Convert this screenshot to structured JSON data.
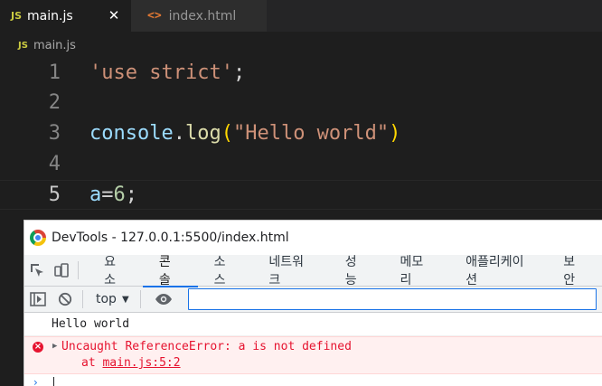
{
  "editor": {
    "tabs": [
      {
        "icon": "JS",
        "label": "main.js",
        "close": "✕"
      },
      {
        "icon": "<>",
        "label": "index.html"
      }
    ],
    "breadcrumb": {
      "icon": "JS",
      "label": "main.js"
    },
    "lines": [
      {
        "number": "1"
      },
      {
        "number": "2"
      },
      {
        "number": "3"
      },
      {
        "number": "4"
      },
      {
        "number": "5"
      }
    ],
    "code": {
      "l1_str": "'use strict'",
      "l1_semi": ";",
      "l3_obj": "console",
      "l3_dot": ".",
      "l3_fn": "log",
      "l3_open": "(",
      "l3_str": "\"Hello world\"",
      "l3_close": ")",
      "l5_var": "a",
      "l5_eq": "=",
      "l5_num": "6",
      "l5_semi": ";"
    }
  },
  "devtools": {
    "title": "DevTools - 127.0.0.1:5500/index.html",
    "tabs": [
      "요소",
      "콘솔",
      "소스",
      "네트워크",
      "성능",
      "메모리",
      "애플리케이션",
      "보안"
    ],
    "active_tab": "콘솔",
    "context": "top",
    "filter_value": "",
    "log_info": "Hello world",
    "error_message": "Uncaught ReferenceError: a is not defined",
    "error_at": "at",
    "error_link": "main.js:5:2",
    "accent": "#1a73e8",
    "error_color": "#e6132f"
  }
}
